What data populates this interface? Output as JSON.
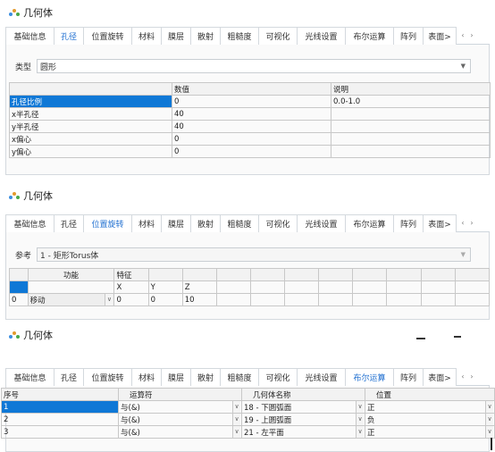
{
  "colors": {
    "accent": "#1f6fd0",
    "selection": "#0f78d6"
  },
  "panel1": {
    "title": "几何体",
    "tabs": [
      "基础信息",
      "孔径",
      "位置旋转",
      "材料",
      "膜层",
      "散射",
      "粗糙度",
      "可视化",
      "光线设置",
      "布尔运算",
      "阵列",
      "表面>"
    ],
    "active_tab": "孔径",
    "type_label": "类型",
    "type_value": "圆形",
    "columns": [
      "",
      "数值",
      "说明"
    ],
    "rows": [
      [
        "孔径比例",
        "0",
        "0.0-1.0"
      ],
      [
        "x半孔径",
        "40",
        ""
      ],
      [
        "y半孔径",
        "40",
        ""
      ],
      [
        "x偏心",
        "0",
        ""
      ],
      [
        "y偏心",
        "0",
        ""
      ]
    ]
  },
  "panel2": {
    "title": "几何体",
    "tabs": [
      "基础信息",
      "孔径",
      "位置旋转",
      "材料",
      "膜层",
      "散射",
      "粗糙度",
      "可视化",
      "光线设置",
      "布尔运算",
      "阵列",
      "表面>"
    ],
    "active_tab": "位置旋转",
    "ref_label": "参考",
    "ref_value": "1 - 矩形Torus体",
    "header1": [
      "功能",
      "特征"
    ],
    "header2": [
      "X",
      "Y",
      "Z"
    ],
    "row": {
      "index": "0",
      "function": "移动",
      "x": "0",
      "y": "0",
      "z": "10"
    }
  },
  "panel3": {
    "title": "几何体",
    "tabs": [
      "基础信息",
      "孔径",
      "位置旋转",
      "材料",
      "膜层",
      "散射",
      "粗糙度",
      "可视化",
      "光线设置",
      "布尔运算",
      "阵列",
      "表面>"
    ],
    "active_tab": "布尔运算",
    "columns": [
      "序号",
      "运算符",
      "几何体名称",
      "位置"
    ],
    "rows": [
      [
        "1",
        "与(&)",
        "18 - 下圆弧面",
        "正"
      ],
      [
        "2",
        "与(&)",
        "19 - 上圆弧面",
        "负"
      ],
      [
        "3",
        "与(&)",
        "21 - 左平面",
        "正"
      ]
    ]
  }
}
